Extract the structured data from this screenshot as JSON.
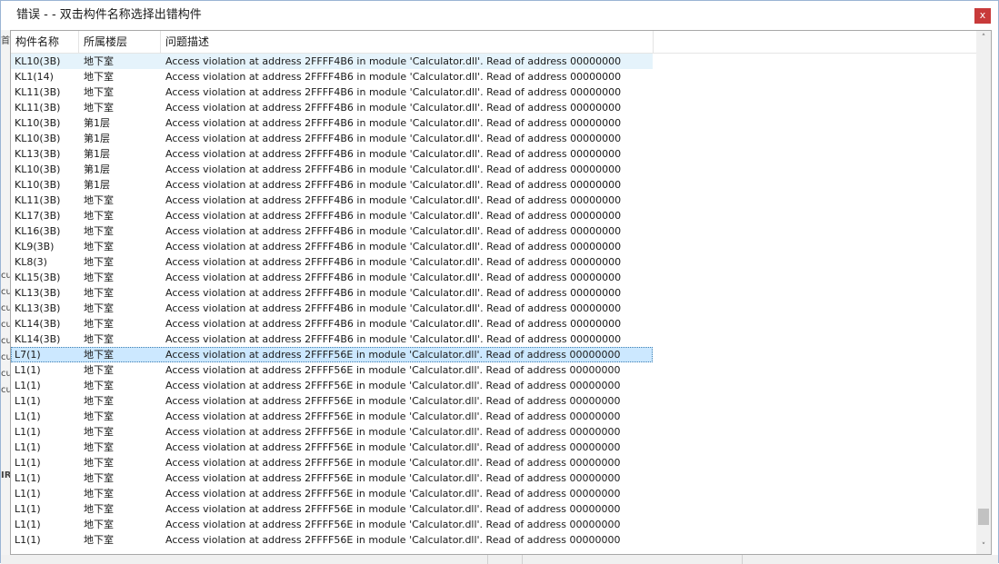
{
  "window": {
    "title": "错误 - - 双击构件名称选择出错构件",
    "close_label": "x"
  },
  "background": {
    "left_marks": [
      "首",
      "cu",
      "cu",
      "cu",
      "cu",
      "cu",
      "cu",
      "cu",
      "cu",
      "IR"
    ]
  },
  "table": {
    "columns": [
      "构件名称",
      "所属楼层",
      "问题描述"
    ],
    "hover_index": 0,
    "selected_index": 19,
    "rows": [
      [
        "KL10(3B)",
        "地下室",
        "Access violation at address 2FFFF4B6 in module 'Calculator.dll'. Read of address 00000000"
      ],
      [
        "KL1(14)",
        "地下室",
        "Access violation at address 2FFFF4B6 in module 'Calculator.dll'. Read of address 00000000"
      ],
      [
        "KL11(3B)",
        "地下室",
        "Access violation at address 2FFFF4B6 in module 'Calculator.dll'. Read of address 00000000"
      ],
      [
        "KL11(3B)",
        "地下室",
        "Access violation at address 2FFFF4B6 in module 'Calculator.dll'. Read of address 00000000"
      ],
      [
        "KL10(3B)",
        "第1层",
        "Access violation at address 2FFFF4B6 in module 'Calculator.dll'. Read of address 00000000"
      ],
      [
        "KL10(3B)",
        "第1层",
        "Access violation at address 2FFFF4B6 in module 'Calculator.dll'. Read of address 00000000"
      ],
      [
        "KL13(3B)",
        "第1层",
        "Access violation at address 2FFFF4B6 in module 'Calculator.dll'. Read of address 00000000"
      ],
      [
        "KL10(3B)",
        "第1层",
        "Access violation at address 2FFFF4B6 in module 'Calculator.dll'. Read of address 00000000"
      ],
      [
        "KL10(3B)",
        "第1层",
        "Access violation at address 2FFFF4B6 in module 'Calculator.dll'. Read of address 00000000"
      ],
      [
        "KL11(3B)",
        "地下室",
        "Access violation at address 2FFFF4B6 in module 'Calculator.dll'. Read of address 00000000"
      ],
      [
        "KL17(3B)",
        "地下室",
        "Access violation at address 2FFFF4B6 in module 'Calculator.dll'. Read of address 00000000"
      ],
      [
        "KL16(3B)",
        "地下室",
        "Access violation at address 2FFFF4B6 in module 'Calculator.dll'. Read of address 00000000"
      ],
      [
        "KL9(3B)",
        "地下室",
        "Access violation at address 2FFFF4B6 in module 'Calculator.dll'. Read of address 00000000"
      ],
      [
        "KL8(3)",
        "地下室",
        "Access violation at address 2FFFF4B6 in module 'Calculator.dll'. Read of address 00000000"
      ],
      [
        "KL15(3B)",
        "地下室",
        "Access violation at address 2FFFF4B6 in module 'Calculator.dll'. Read of address 00000000"
      ],
      [
        "KL13(3B)",
        "地下室",
        "Access violation at address 2FFFF4B6 in module 'Calculator.dll'. Read of address 00000000"
      ],
      [
        "KL13(3B)",
        "地下室",
        "Access violation at address 2FFFF4B6 in module 'Calculator.dll'. Read of address 00000000"
      ],
      [
        "KL14(3B)",
        "地下室",
        "Access violation at address 2FFFF4B6 in module 'Calculator.dll'. Read of address 00000000"
      ],
      [
        "KL14(3B)",
        "地下室",
        "Access violation at address 2FFFF4B6 in module 'Calculator.dll'. Read of address 00000000"
      ],
      [
        "L7(1)",
        "地下室",
        "Access violation at address 2FFFF56E in module 'Calculator.dll'. Read of address 00000000"
      ],
      [
        "L1(1)",
        "地下室",
        "Access violation at address 2FFFF56E in module 'Calculator.dll'. Read of address 00000000"
      ],
      [
        "L1(1)",
        "地下室",
        "Access violation at address 2FFFF56E in module 'Calculator.dll'. Read of address 00000000"
      ],
      [
        "L1(1)",
        "地下室",
        "Access violation at address 2FFFF56E in module 'Calculator.dll'. Read of address 00000000"
      ],
      [
        "L1(1)",
        "地下室",
        "Access violation at address 2FFFF56E in module 'Calculator.dll'. Read of address 00000000"
      ],
      [
        "L1(1)",
        "地下室",
        "Access violation at address 2FFFF56E in module 'Calculator.dll'. Read of address 00000000"
      ],
      [
        "L1(1)",
        "地下室",
        "Access violation at address 2FFFF56E in module 'Calculator.dll'. Read of address 00000000"
      ],
      [
        "L1(1)",
        "地下室",
        "Access violation at address 2FFFF56E in module 'Calculator.dll'. Read of address 00000000"
      ],
      [
        "L1(1)",
        "地下室",
        "Access violation at address 2FFFF56E in module 'Calculator.dll'. Read of address 00000000"
      ],
      [
        "L1(1)",
        "地下室",
        "Access violation at address 2FFFF56E in module 'Calculator.dll'. Read of address 00000000"
      ],
      [
        "L1(1)",
        "地下室",
        "Access violation at address 2FFFF56E in module 'Calculator.dll'. Read of address 00000000"
      ],
      [
        "L1(1)",
        "地下室",
        "Access violation at address 2FFFF56E in module 'Calculator.dll'. Read of address 00000000"
      ],
      [
        "L1(1)",
        "地下室",
        "Access violation at address 2FFFF56E in module 'Calculator.dll'. Read of address 00000000"
      ]
    ]
  },
  "scrollbar": {
    "up_icon": "chevron-up-icon",
    "down_icon": "chevron-down-icon",
    "position": 0.97
  },
  "colors": {
    "close_button": "#c83a3a",
    "selected_row": "#cce8ff",
    "hover_row": "#e5f3fb"
  }
}
